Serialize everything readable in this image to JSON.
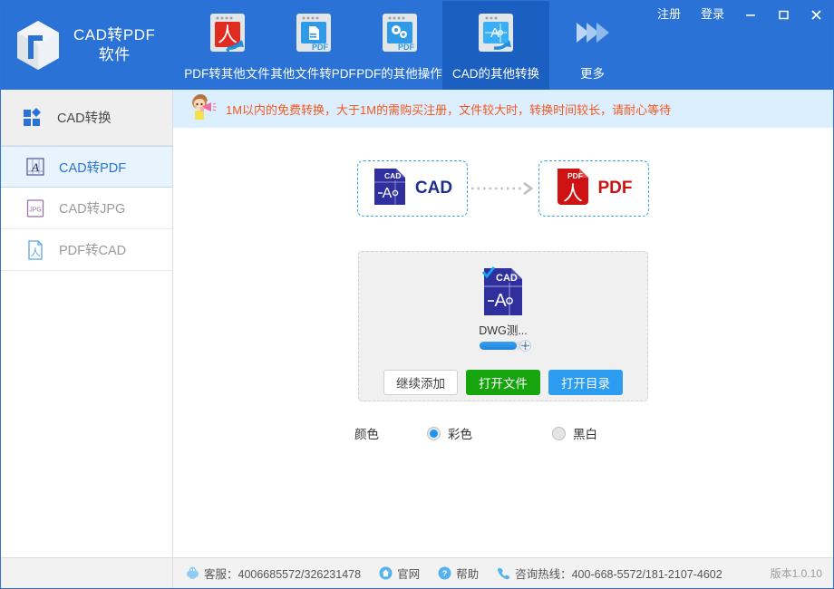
{
  "window": {
    "brand_line1": "CAD转PDF",
    "brand_line2": "软件",
    "register": "注册",
    "login": "登录",
    "minimize_icon": "minimize-icon",
    "maximize_icon": "maximize-icon",
    "close_icon": "close-icon"
  },
  "nav": {
    "items": [
      {
        "label": "PDF转其他文件",
        "icon": "pdf-to-other-icon",
        "active": false
      },
      {
        "label": "其他文件转PDF",
        "icon": "other-to-pdf-icon",
        "active": false
      },
      {
        "label": "PDF的其他操作",
        "icon": "pdf-operations-icon",
        "active": false
      },
      {
        "label": "CAD的其他转换",
        "icon": "cad-conversion-icon",
        "active": true
      },
      {
        "label": "更多",
        "icon": "more-arrows-icon",
        "active": false
      }
    ]
  },
  "sidebar": {
    "header": {
      "label": "CAD转换",
      "icon": "grid-squares-icon"
    },
    "items": [
      {
        "label": "CAD转PDF",
        "icon": "cad-file-icon",
        "active": true
      },
      {
        "label": "CAD转JPG",
        "icon": "jpg-file-icon",
        "active": false
      },
      {
        "label": "PDF转CAD",
        "icon": "pdf-file-icon",
        "active": false
      }
    ]
  },
  "notice": {
    "icon": "megaphone-girl-icon",
    "text": "1M以内的免费转换，大于1M的需购买注册，文件较大时，转换时间较长，请耐心等待"
  },
  "flow": {
    "source_label": "CAD",
    "source_icon": "cad-file-icon",
    "target_label": "PDF",
    "target_icon": "pdf-file-icon",
    "arrow_icon": "dotted-arrow-right-icon"
  },
  "drop_area": {
    "file": {
      "icon": "cad-file-checked-icon",
      "name": "DWG测...",
      "progress_percent": 78,
      "status_icon": "spinner-icon"
    },
    "buttons": {
      "continue_add": "继续添加",
      "open_file": "打开文件",
      "open_folder": "打开目录"
    }
  },
  "options": {
    "color_label": "颜色",
    "choices": [
      {
        "label": "彩色",
        "selected": true
      },
      {
        "label": "黑白",
        "selected": false
      }
    ]
  },
  "footer": {
    "service": {
      "icon": "qq-penguin-icon",
      "text": "客服：4006685572/326231478"
    },
    "website": {
      "icon": "home-icon",
      "text": "官网"
    },
    "help": {
      "icon": "question-icon",
      "text": "帮助"
    },
    "hotline": {
      "icon": "phone-icon",
      "text": "咨询热线：400-668-5572/181-2107-4602"
    },
    "version": "版本1.0.10"
  },
  "colors": {
    "header_blue": "#2a72d6",
    "active_nav_blue": "#1b5fc0",
    "notice_bg": "#dcefff",
    "notice_text": "#f4581f",
    "accent_blue": "#2b9cf0",
    "green": "#16a50c",
    "sidebar_active_bg": "#e8f4fd"
  }
}
